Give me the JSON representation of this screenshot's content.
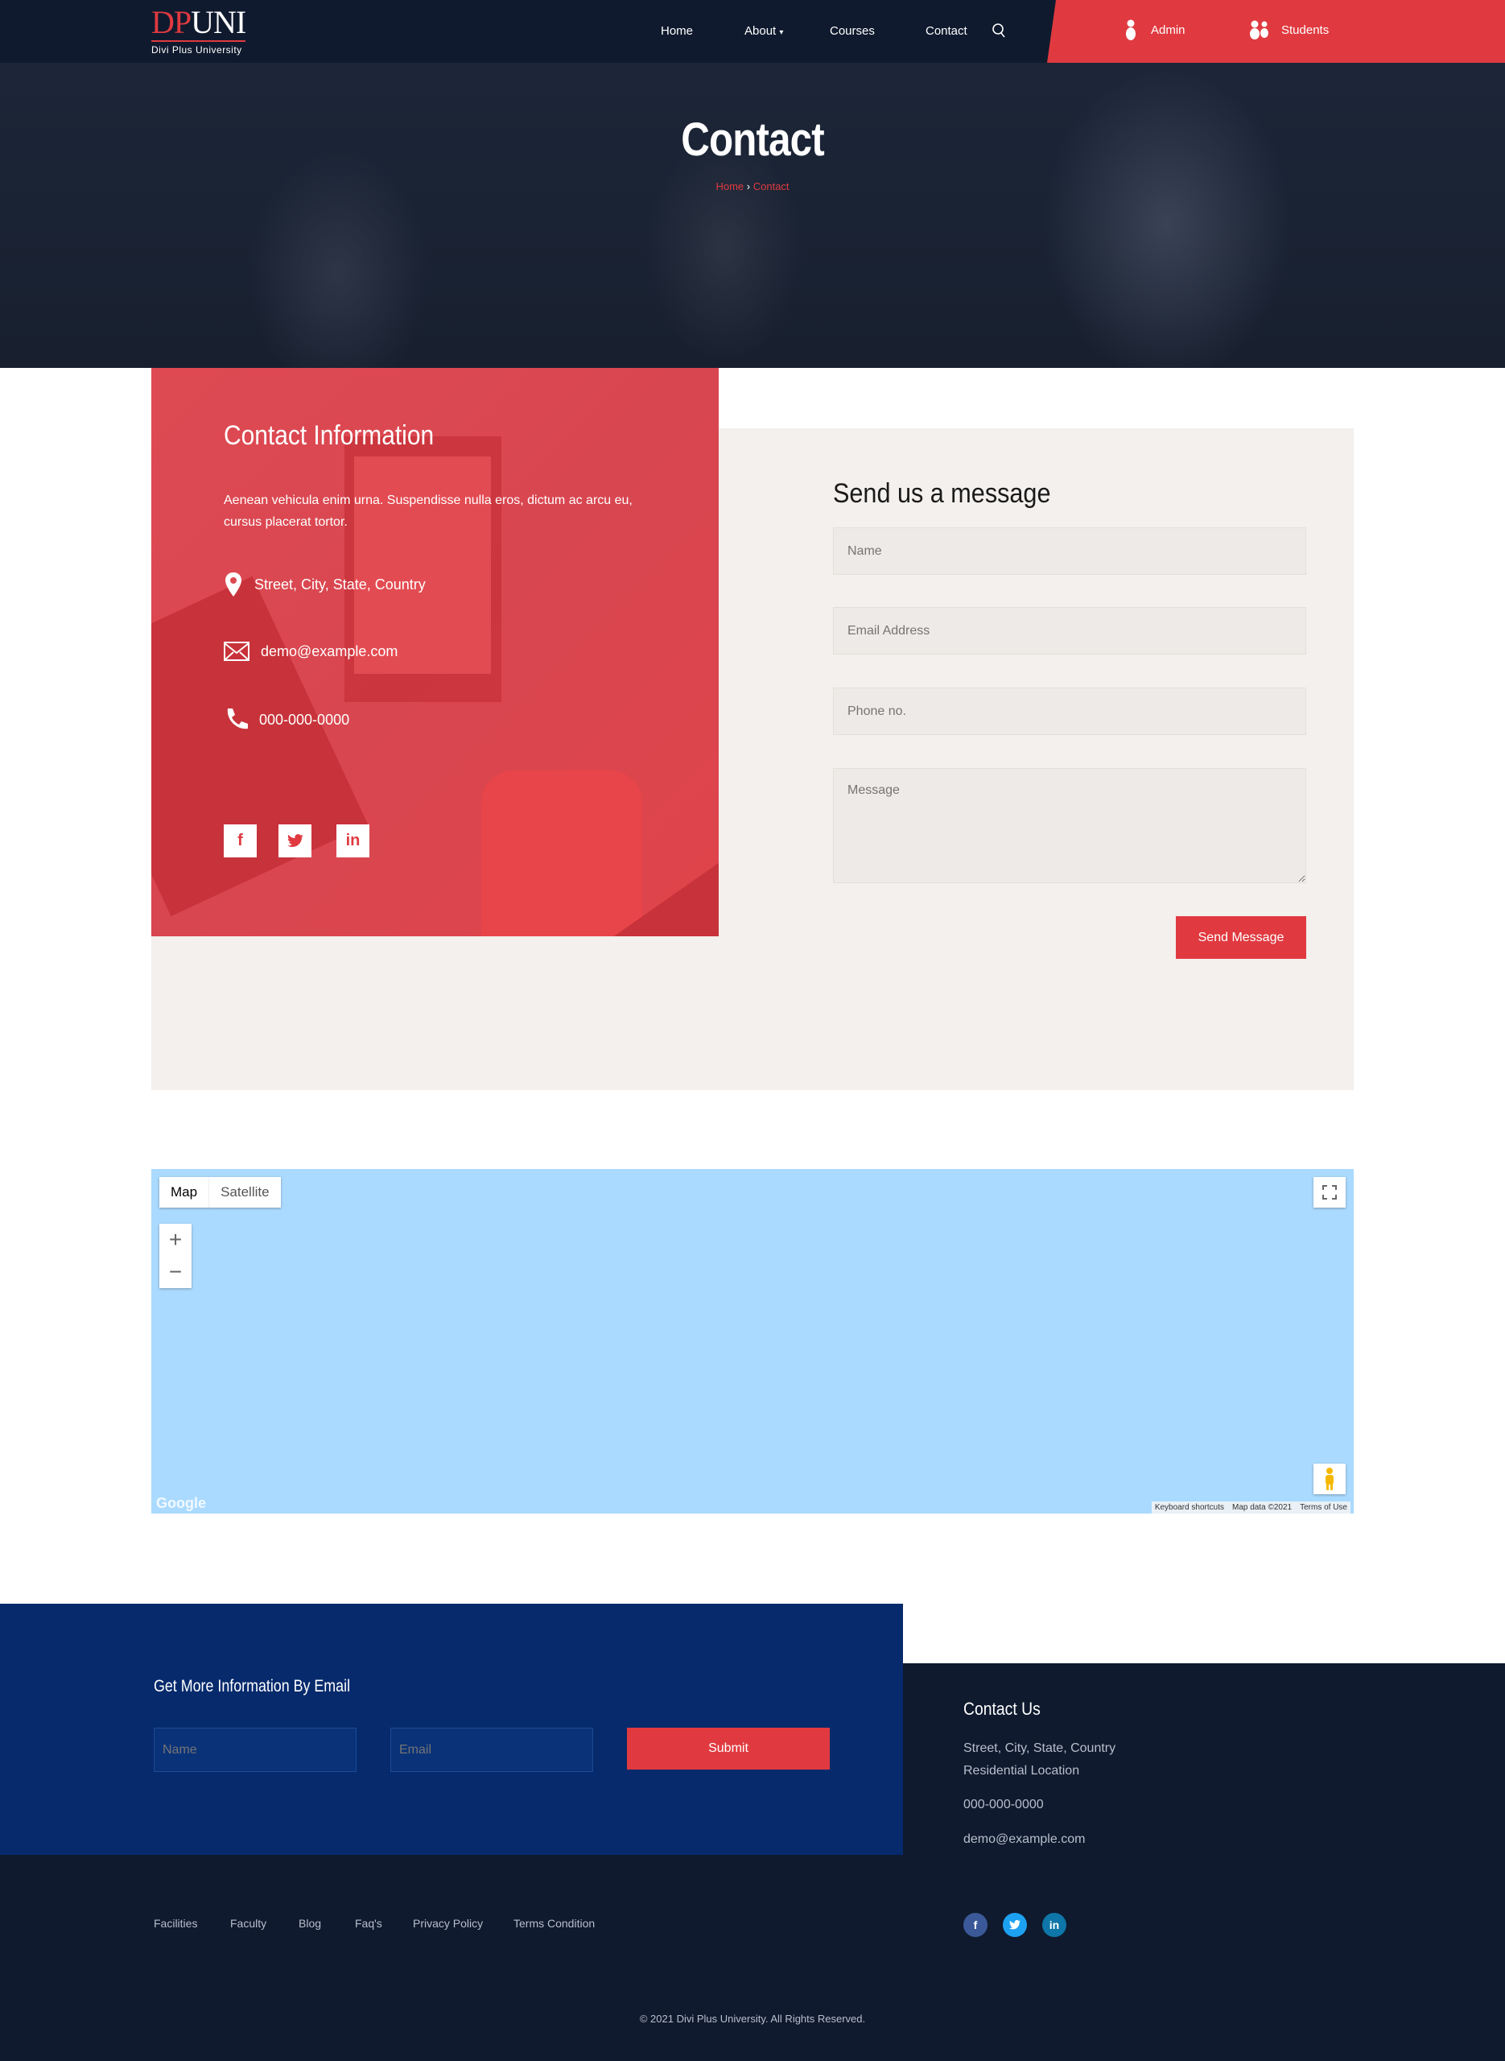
{
  "header": {
    "logo_main_a": "DP",
    "logo_main_b": "UNI",
    "logo_sub": "Divi Plus University",
    "nav": [
      {
        "label": "Home"
      },
      {
        "label": "About"
      },
      {
        "label": "Courses"
      },
      {
        "label": "Contact"
      }
    ],
    "admin_label": "Admin",
    "students_label": "Students"
  },
  "hero": {
    "title": "Contact",
    "breadcrumb_home": "Home",
    "breadcrumb_sep": "›",
    "breadcrumb_current": "Contact"
  },
  "contact_info": {
    "title": "Contact Information",
    "text": "Aenean vehicula enim urna. Suspendisse nulla eros, dictum ac arcu eu, cursus placerat tortor.",
    "address": "Street, City, State, Country",
    "email": "demo@example.com",
    "phone": "000-000-0000"
  },
  "form": {
    "title": "Send us a message",
    "name_placeholder": "Name",
    "email_placeholder": "Email Address",
    "phone_placeholder": "Phone no.",
    "message_placeholder": "Message",
    "submit": "Send Message"
  },
  "map": {
    "tab_map": "Map",
    "tab_satellite": "Satellite",
    "zoom_in": "+",
    "zoom_out": "−",
    "google": "Google",
    "keyboard": "Keyboard shortcuts",
    "mapdata": "Map data ©2021",
    "terms": "Terms of Use"
  },
  "newsletter": {
    "title": "Get More Information By Email",
    "name_placeholder": "Name",
    "email_placeholder": "Email",
    "submit": "Submit"
  },
  "footer": {
    "links": [
      "Facilities",
      "Faculty",
      "Blog",
      "Faq's",
      "Privacy Policy",
      "Terms Condition"
    ],
    "contact_title": "Contact Us",
    "address1": "Street, City, State, Country",
    "address2": "Residential Location",
    "phone": "000-000-0000",
    "email": "demo@example.com",
    "copyright": "© 2021 Divi Plus University. All Rights Reserved."
  },
  "colors": {
    "accent": "#e03a40",
    "navy": "#0f1a2e",
    "blue": "#062a6c",
    "map": "#aadaff"
  }
}
